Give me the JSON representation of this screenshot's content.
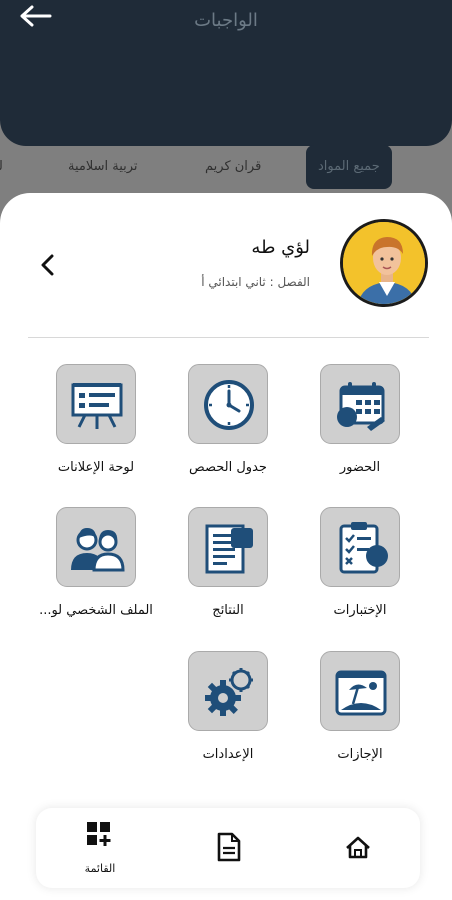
{
  "background": {
    "title": "الواجبات",
    "tabs": [
      "جميع المواد",
      "قران كريم",
      "تربية اسلامية",
      "لغ"
    ]
  },
  "profile": {
    "name": "لؤي طه",
    "class_line": "الفصل : ثاني ابتدائي أ"
  },
  "menu": {
    "items": [
      {
        "label": "الحضور",
        "icon": "calendar-icon"
      },
      {
        "label": "جدول الحصص",
        "icon": "clock-icon"
      },
      {
        "label": "لوحة الإعلانات",
        "icon": "presentation-board-icon"
      },
      {
        "label": "الإختبارات",
        "icon": "checklist-icon"
      },
      {
        "label": "النتائج",
        "icon": "report-document-icon"
      },
      {
        "label": "الملف الشخصي لو...",
        "icon": "parents-icon"
      },
      {
        "label": "الإجازات",
        "icon": "vacation-icon"
      },
      {
        "label": "الإعدادات",
        "icon": "settings-gears-icon"
      }
    ]
  },
  "bottom_nav": {
    "menu_label": "القائمة"
  },
  "colors": {
    "accent": "#1f4e79",
    "header_dark": "#1f2b38",
    "tile_bg": "#cfcfcf",
    "avatar_bg": "#f3c22b"
  }
}
